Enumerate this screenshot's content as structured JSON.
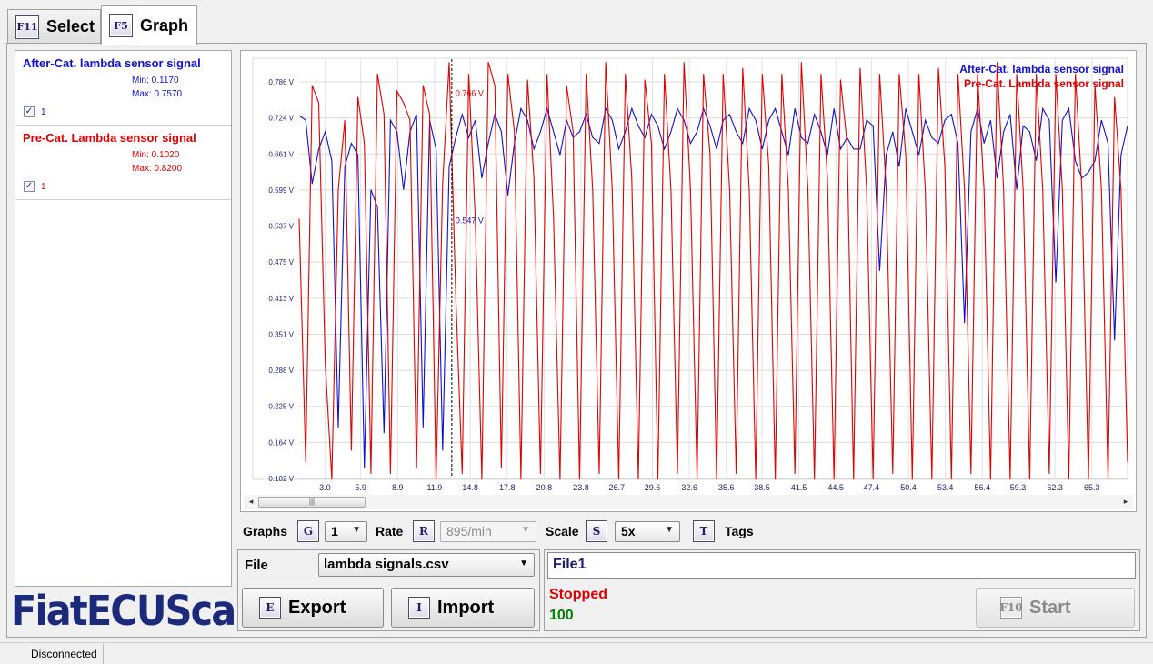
{
  "tabs": [
    {
      "key": "F11",
      "label": "Select"
    },
    {
      "key": "F5",
      "label": "Graph"
    }
  ],
  "signals": [
    {
      "title": "After-Cat. lambda sensor signal",
      "color": "#1010d0",
      "min": "Min: 0.1170",
      "max": "Max: 0.7570",
      "check_label": "1",
      "checked": true
    },
    {
      "title": "Pre-Cat. Lambda sensor signal",
      "color": "#e00000",
      "min": "Min: 0.1020",
      "max": "Max: 0.8200",
      "check_label": "1",
      "checked": true
    }
  ],
  "logo": "FiatECUScan",
  "chart_data": {
    "type": "line",
    "y_ticks": [
      "0.786 V",
      "0.724 V",
      "0.661 V",
      "0.599 V",
      "0.537 V",
      "0.475 V",
      "0.413 V",
      "0.351 V",
      "0.288 V",
      "0.225 V",
      "0.164 V",
      "0.102 V"
    ],
    "ylim": [
      0.102,
      0.786
    ],
    "x_ticks": [
      "3.0",
      "5.9",
      "8.9",
      "11.9",
      "14.8",
      "17.8",
      "20.8",
      "23.8",
      "26.7",
      "29.6",
      "32.6",
      "35.6",
      "38.5",
      "41.5",
      "44.5",
      "47.4",
      "50.4",
      "53.4",
      "56.4",
      "59.3",
      "62.3",
      "65.3"
    ],
    "xlim": [
      0.9,
      68.2
    ],
    "grid": true,
    "legend_position": "top-right",
    "cursor": {
      "x": 13.3,
      "labels": [
        {
          "series": 1,
          "text": "0.766 V",
          "y": 0.766
        },
        {
          "series": 0,
          "text": "0.547 V",
          "y": 0.547
        }
      ]
    },
    "series": [
      {
        "name": "After-Cat. lambda sensor signal",
        "color": "#1010d0",
        "values": [
          0.728,
          0.72,
          0.61,
          0.67,
          0.7,
          0.65,
          0.19,
          0.64,
          0.68,
          0.66,
          0.12,
          0.6,
          0.57,
          0.18,
          0.72,
          0.7,
          0.6,
          0.7,
          0.73,
          0.19,
          0.72,
          0.67,
          0.15,
          0.64,
          0.69,
          0.73,
          0.69,
          0.72,
          0.62,
          0.68,
          0.73,
          0.7,
          0.59,
          0.68,
          0.74,
          0.72,
          0.67,
          0.7,
          0.74,
          0.7,
          0.66,
          0.72,
          0.69,
          0.7,
          0.73,
          0.69,
          0.68,
          0.74,
          0.72,
          0.67,
          0.7,
          0.74,
          0.71,
          0.69,
          0.73,
          0.71,
          0.67,
          0.7,
          0.74,
          0.72,
          0.68,
          0.7,
          0.74,
          0.71,
          0.67,
          0.72,
          0.73,
          0.7,
          0.68,
          0.74,
          0.72,
          0.67,
          0.72,
          0.74,
          0.7,
          0.66,
          0.74,
          0.69,
          0.68,
          0.73,
          0.7,
          0.66,
          0.74,
          0.67,
          0.69,
          0.67,
          0.67,
          0.72,
          0.71,
          0.46,
          0.66,
          0.7,
          0.64,
          0.74,
          0.7,
          0.66,
          0.72,
          0.69,
          0.68,
          0.72,
          0.73,
          0.68,
          0.37,
          0.7,
          0.74,
          0.68,
          0.72,
          0.62,
          0.7,
          0.73,
          0.6,
          0.71,
          0.7,
          0.65,
          0.74,
          0.72,
          0.44,
          0.72,
          0.74,
          0.65,
          0.62,
          0.63,
          0.65,
          0.72,
          0.68,
          0.34,
          0.66,
          0.71
        ]
      },
      {
        "name": "Pre-Cat. Lambda sensor signal",
        "color": "#e00000",
        "values": [
          0.55,
          0.13,
          0.78,
          0.75,
          0.3,
          0.1,
          0.6,
          0.72,
          0.15,
          0.76,
          0.68,
          0.11,
          0.8,
          0.73,
          0.11,
          0.77,
          0.75,
          0.72,
          0.12,
          0.78,
          0.73,
          0.1,
          0.61,
          0.82,
          0.42,
          0.11,
          0.8,
          0.55,
          0.1,
          0.82,
          0.78,
          0.12,
          0.8,
          0.7,
          0.1,
          0.79,
          0.62,
          0.11,
          0.8,
          0.55,
          0.1,
          0.78,
          0.7,
          0.1,
          0.8,
          0.6,
          0.11,
          0.82,
          0.6,
          0.1,
          0.8,
          0.62,
          0.1,
          0.79,
          0.68,
          0.1,
          0.8,
          0.6,
          0.11,
          0.82,
          0.6,
          0.1,
          0.8,
          0.66,
          0.1,
          0.8,
          0.6,
          0.11,
          0.81,
          0.6,
          0.1,
          0.8,
          0.64,
          0.1,
          0.8,
          0.6,
          0.11,
          0.82,
          0.6,
          0.1,
          0.8,
          0.62,
          0.1,
          0.79,
          0.68,
          0.1,
          0.81,
          0.6,
          0.1,
          0.8,
          0.6,
          0.11,
          0.8,
          0.66,
          0.1,
          0.8,
          0.6,
          0.1,
          0.81,
          0.64,
          0.1,
          0.8,
          0.6,
          0.11,
          0.8,
          0.6,
          0.1,
          0.82,
          0.6,
          0.1,
          0.8,
          0.6,
          0.1,
          0.8,
          0.6,
          0.11,
          0.8,
          0.6,
          0.1,
          0.8,
          0.6,
          0.1,
          0.78,
          0.6,
          0.1,
          0.76,
          0.6,
          0.13
        ]
      }
    ]
  },
  "controls": {
    "graphs_label": "Graphs",
    "graphs_key": "G",
    "graphs_value": "1",
    "rate_label": "Rate",
    "rate_key": "R",
    "rate_value": "895/min",
    "scale_label": "Scale",
    "scale_key": "S",
    "scale_value": "5x",
    "tags_key": "T",
    "tags_label": "Tags"
  },
  "file": {
    "label": "File",
    "selected": "lambda signals.csv",
    "export_key": "E",
    "export_label": "Export",
    "import_key": "I",
    "import_label": "Import"
  },
  "status": {
    "file_name": "File1",
    "state": "Stopped",
    "count": "100",
    "start_key": "F10",
    "start_label": "Start"
  },
  "statusbar": {
    "connection": "Disconnected"
  }
}
